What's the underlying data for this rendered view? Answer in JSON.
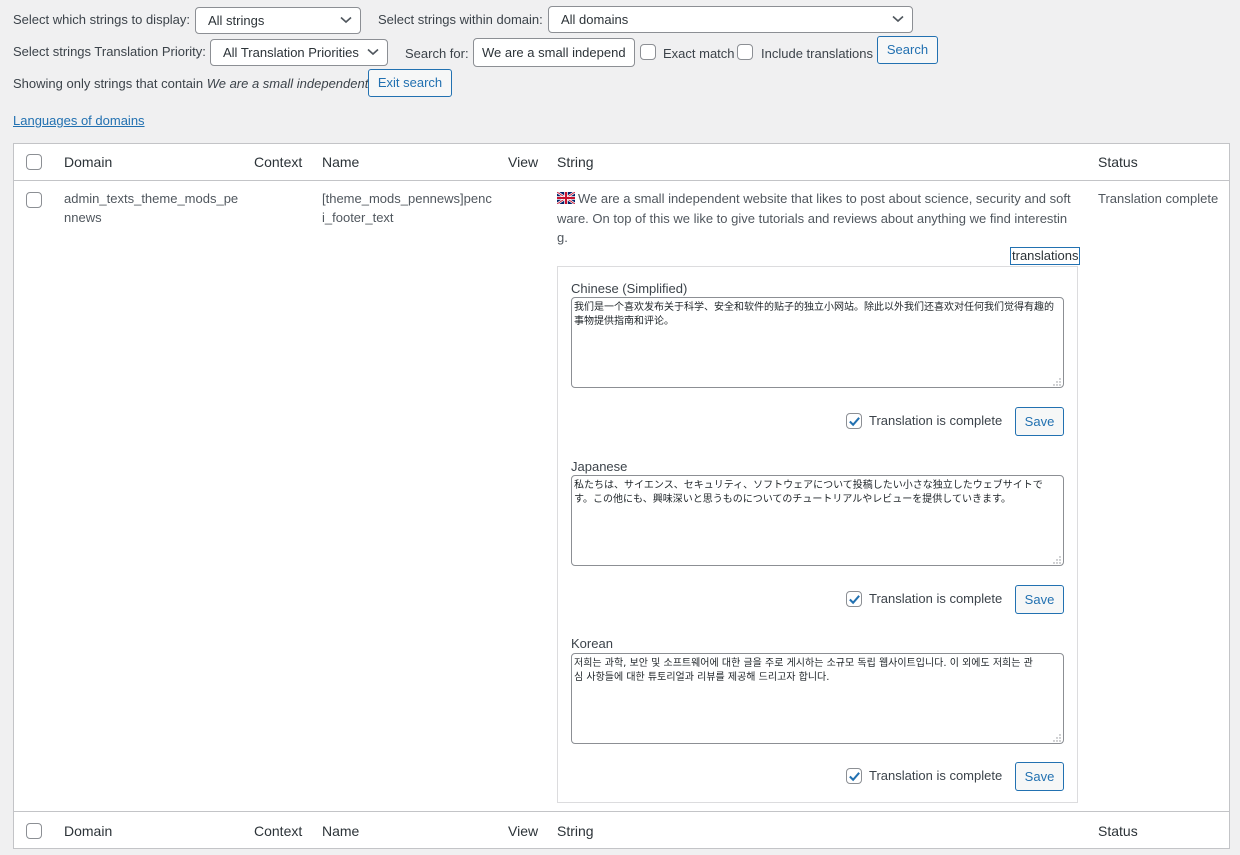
{
  "filters": {
    "strings_label": "Select which strings to display:",
    "strings_value": "All strings",
    "domain_label": "Select strings within domain:",
    "domain_value": "All domains",
    "priority_label": "Select strings Translation Priority:",
    "priority_value": "All Translation Priorities",
    "search_label": "Search for:",
    "search_value": "We are a small independ",
    "exact_match_label": "Exact match",
    "exact_match_checked": false,
    "include_translations_label": "Include translations",
    "include_translations_checked": false,
    "search_button": "Search",
    "showing_prefix": "Showing only strings that contain",
    "showing_term": "We are a small independent",
    "exit_search_button": "Exit search"
  },
  "languages_of_domains_link": "Languages of domains",
  "table": {
    "columns": {
      "domain": "Domain",
      "context": "Context",
      "name": "Name",
      "view": "View",
      "string": "String",
      "status": "Status"
    },
    "rows": [
      {
        "domain_line1": "admin_texts_theme_mods_pe",
        "domain_line2": "nnews",
        "context": "",
        "name_line1": "[theme_mods_pennews]penc",
        "name_line2": "i_footer_text",
        "view": "",
        "flag_icon": "uk-flag-icon",
        "string_line1": "We are a small independent website that likes to post about science, security and soft",
        "string_line2": "ware. On top of this we like to give tutorials and reviews about anything we find interestin",
        "string_line3": "g.",
        "status": "Translation complete",
        "translations_link": "translations",
        "translations": [
          {
            "language": "Chinese (Simplified)",
            "text_line1": "我们是一个喜欢发布关于科学、安全和软件的贴子的独立小网站。除此以外我们还喜欢对任何我们觉得有趣的",
            "text_line2": "事物提供指南和评论。",
            "complete_label": "Translation is complete",
            "complete_checked": true,
            "save_button": "Save"
          },
          {
            "language": "Japanese",
            "text_line1": "私たちは、サイエンス、セキュリティ、ソフトウェアについて投稿したい小さな独立したウェブサイトで",
            "text_line2": "す。この他にも、興味深いと思うものについてのチュートリアルやレビューを提供していきます。",
            "complete_label": "Translation is complete",
            "complete_checked": true,
            "save_button": "Save"
          },
          {
            "language": "Korean",
            "text_line1": "저희는 과학, 보안 및 소프트웨어에 대한 글을 주로 게시하는 소규모 독립 웹사이트입니다. 이 외에도 저희는 관",
            "text_line2": "심 사항들에 대한 튜토리얼과 리뷰를 제공해 드리고자 합니다.",
            "complete_label": "Translation is complete",
            "complete_checked": true,
            "save_button": "Save"
          }
        ]
      }
    ]
  },
  "colors": {
    "accent": "#2271b1",
    "background": "#f0f0f1",
    "border": "#c3c4c7"
  }
}
